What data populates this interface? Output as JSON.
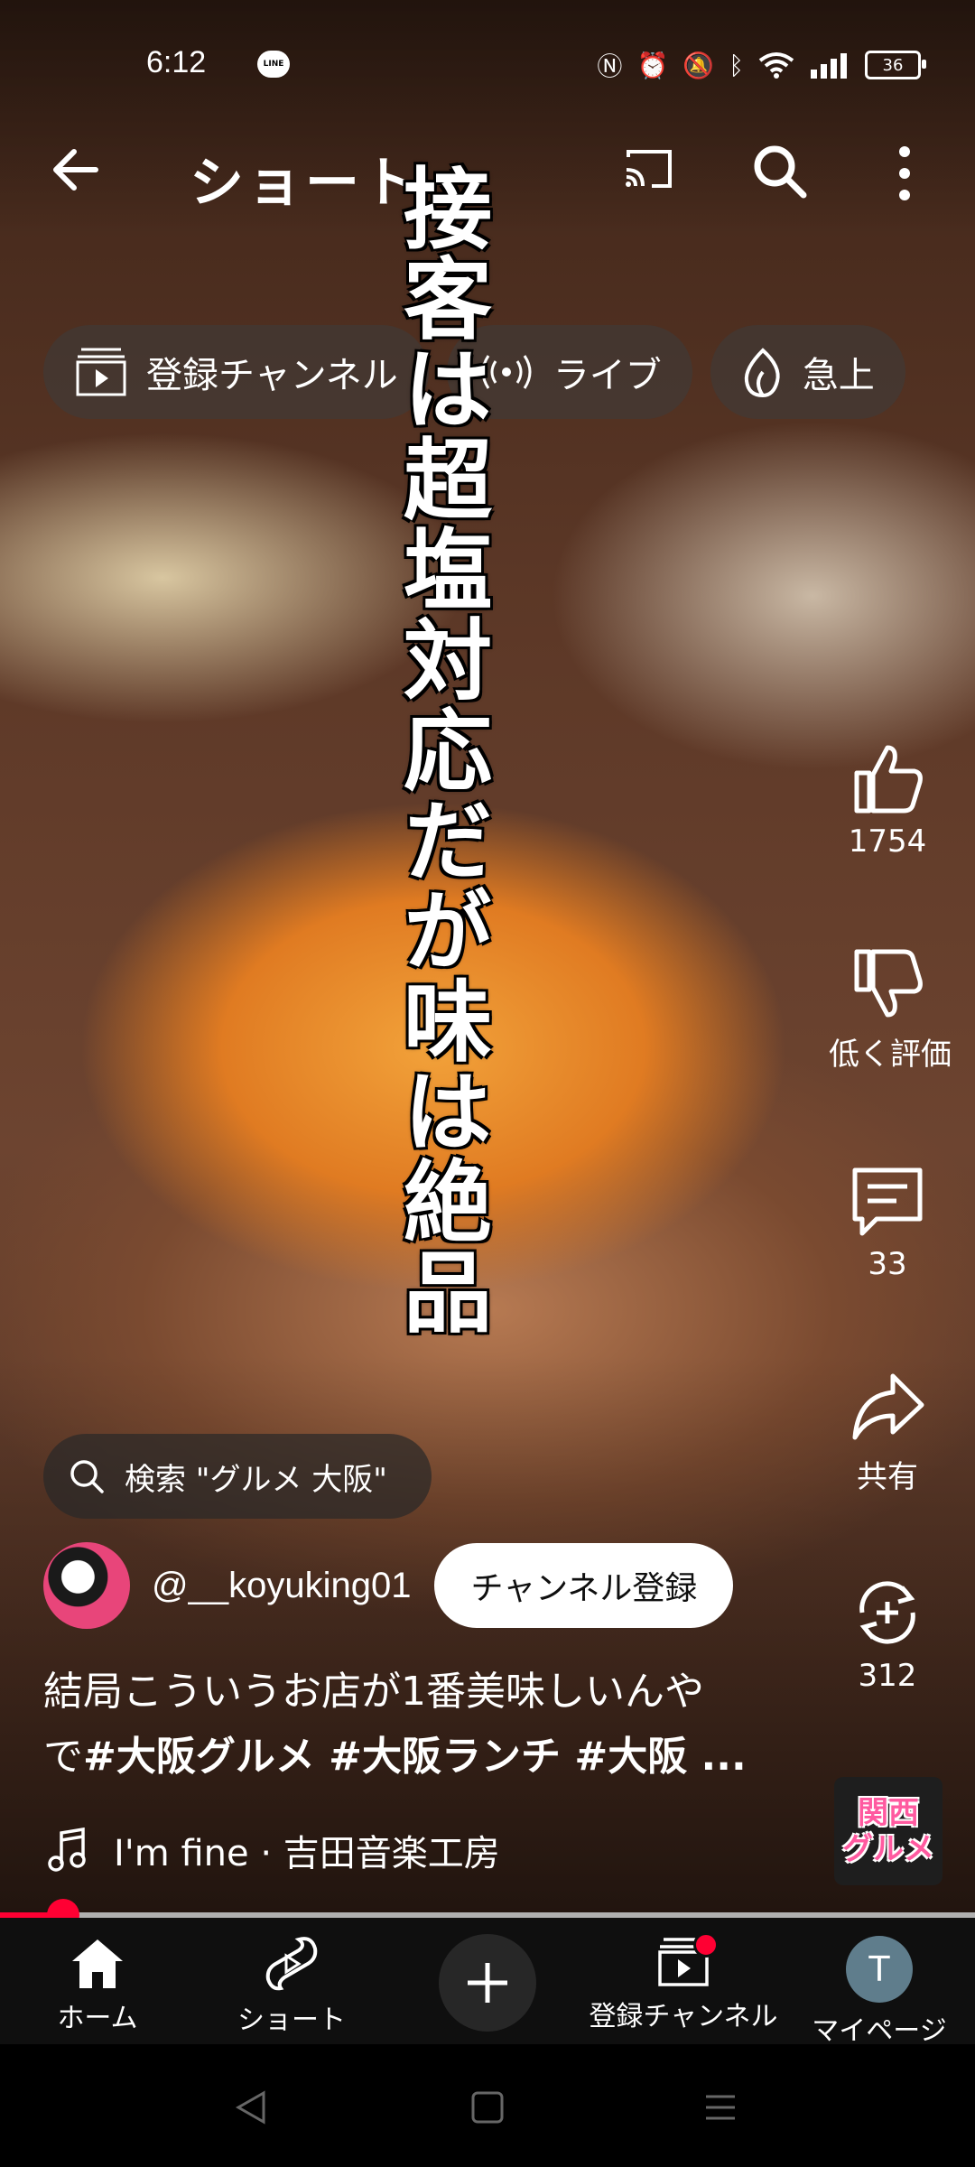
{
  "status_bar": {
    "time": "6:12",
    "battery": "36"
  },
  "header": {
    "title": "ショート"
  },
  "chips": [
    {
      "label": "登録チャンネル",
      "icon": "subscriptions-icon"
    },
    {
      "label": "ライブ",
      "icon": "live-icon"
    },
    {
      "label": "急上",
      "icon": "trending-icon"
    }
  ],
  "video": {
    "overlay_caption": "接客は超塩対応だが味は絶品",
    "sticker_line1": "関西",
    "sticker_line2": "グルメ"
  },
  "actions": {
    "like_count": "1754",
    "dislike_label": "低く評価",
    "comment_count": "33",
    "share_label": "共有",
    "remix_count": "312"
  },
  "search_suggestion": "検索 \"グルメ 大阪\"",
  "channel": {
    "handle": "@__koyuking01",
    "subscribe_label": "チャンネル登録"
  },
  "description": {
    "text_line1": "結局こういうお店が1番美味しいんや",
    "text_line2_prefix": "で",
    "text_line2_tags": "#大阪グルメ #大阪ランチ #大阪 ..."
  },
  "music": {
    "label": "I'm fine · 吉田音楽工房"
  },
  "progress": {
    "fraction": 0.065
  },
  "bottom_nav": {
    "home": "ホーム",
    "shorts": "ショート",
    "subscriptions": "登録チャンネル",
    "mypage": "マイページ",
    "avatar_initial": "T"
  },
  "colors": {
    "accent": "#ff0033",
    "nav_bg": "#0f0f0f"
  }
}
